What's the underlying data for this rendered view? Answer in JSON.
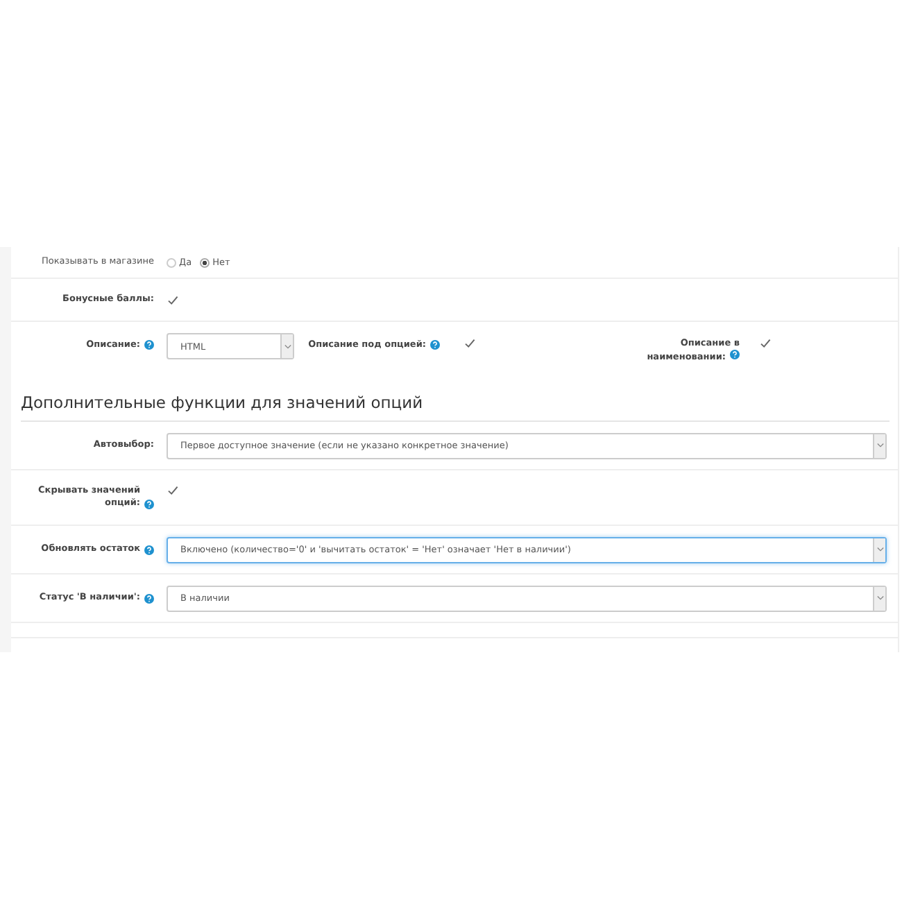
{
  "fields_top": [
    {
      "kind": "radio",
      "label": "Показывать в магазине",
      "help": false,
      "options": [
        {
          "label": "Да",
          "selected": false
        },
        {
          "label": "Нет",
          "selected": true
        }
      ]
    },
    {
      "kind": "checkbox",
      "label": "Бонусные баллы:",
      "help": false,
      "checked": true
    },
    {
      "kind": "description",
      "label": "Описание:",
      "help": true,
      "value": "HTML",
      "under_option": {
        "label": "Описание под опцией:",
        "help": true,
        "checked": true
      },
      "in_name": {
        "label": "Описание в наименовании:",
        "help": true,
        "checked": true
      }
    }
  ],
  "section": {
    "title": "Дополнительные функции для значений опций",
    "fields": [
      {
        "kind": "select",
        "label": "Автовыбор:",
        "help": false,
        "value": "Первое доступное значение (если не указано конкретное значение)",
        "focused": false
      },
      {
        "kind": "checkbox",
        "label": "Скрывать значений опций:",
        "help": true,
        "checked": true
      },
      {
        "kind": "select",
        "label": "Обновлять остаток",
        "help": true,
        "value": "Включено (количество='0' и 'вычитать остаток' = 'Нет' означает 'Нет в наличии')",
        "focused": true
      },
      {
        "kind": "select",
        "label": "Статус 'В наличии':",
        "help": true,
        "value": "В наличии",
        "focused": false
      }
    ]
  }
}
